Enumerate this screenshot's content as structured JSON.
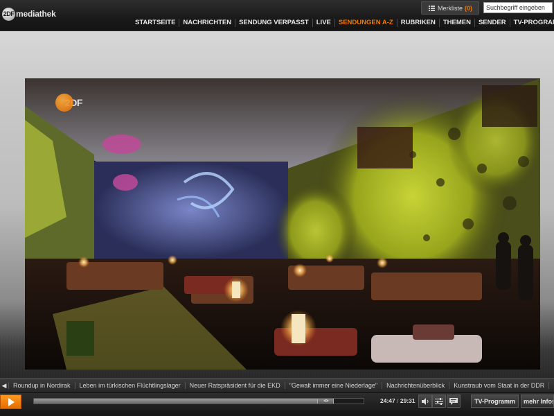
{
  "header": {
    "logo_mark": "2DF",
    "logo_text": "mediathek",
    "merkliste_label": "Merkliste",
    "merkliste_count": "(0)",
    "search_placeholder": "Suchbegriff eingeben",
    "nav": [
      {
        "label": "STARTSEITE",
        "active": false
      },
      {
        "label": "NACHRICHTEN",
        "active": false
      },
      {
        "label": "SENDUNG VERPASST",
        "active": false
      },
      {
        "label": "LIVE",
        "active": false
      },
      {
        "label": "SENDUNGEN A-Z",
        "active": true
      },
      {
        "label": "RUBRIKEN",
        "active": false
      },
      {
        "label": "THEMEN",
        "active": false
      },
      {
        "label": "SENDER",
        "active": false
      },
      {
        "label": "TV-PROGRAMM",
        "active": false
      }
    ]
  },
  "video": {
    "channel_bug": "2DF"
  },
  "ticker": {
    "items": [
      "Roundup in Nordirak",
      "Leben im türkischen Flüchtlingslager",
      "Neuer Ratspräsident für die EKD",
      "\"Gewalt immer eine Niederlage\"",
      "Nachrichtenüberblick",
      "Kunstraub vom Staat in der DDR",
      "Na"
    ]
  },
  "player": {
    "progress_fraction": 0.86,
    "thumb_glyph": "<·>",
    "current_time": "24:47",
    "separator": "/",
    "total_time": "29:31",
    "tv_programm_label": "TV-Programm",
    "mehr_info_label": "mehr Infos"
  },
  "colors": {
    "accent": "#f07800",
    "play_button": "#ff8a00"
  }
}
